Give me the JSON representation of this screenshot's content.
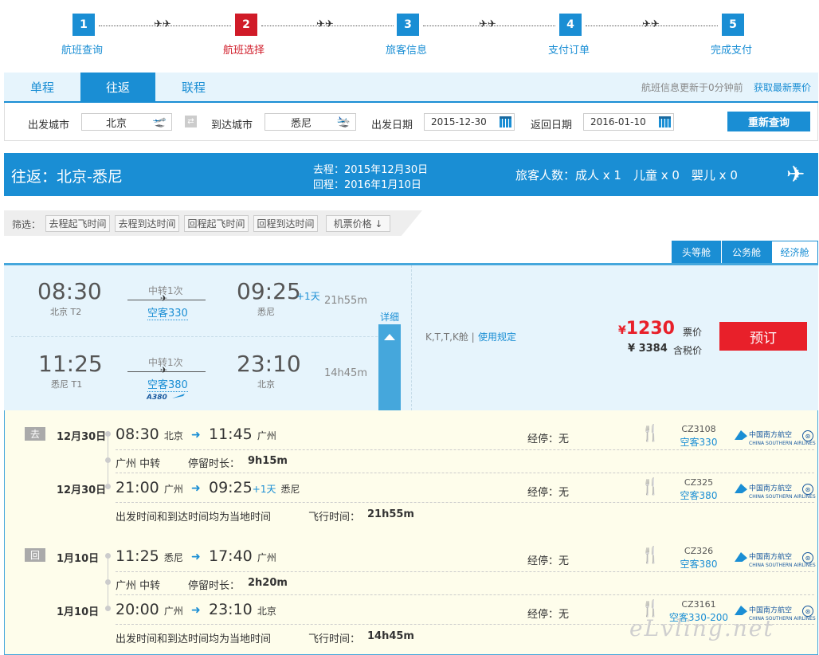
{
  "steps": [
    {
      "num": "1",
      "label": "航班查询"
    },
    {
      "num": "2",
      "label": "航班选择"
    },
    {
      "num": "3",
      "label": "旅客信息"
    },
    {
      "num": "4",
      "label": "支付订单"
    },
    {
      "num": "5",
      "label": "完成支付"
    }
  ],
  "trip_tabs": [
    "单程",
    "往返",
    "联程"
  ],
  "update_text": "航班信息更新于0分钟前",
  "refresh_link": "获取最新票价",
  "search": {
    "from_label": "出发城市",
    "from_value": "北京",
    "to_label": "到达城市",
    "to_value": "悉尼",
    "depart_label": "出发日期",
    "depart_value": "2015-12-30",
    "return_label": "返回日期",
    "return_value": "2016-01-10",
    "button": "重新查询"
  },
  "banner": {
    "route": "往返：北京-悉尼",
    "out_label": "去程：2015年12月30日",
    "ret_label": "回程：2016年1月10日",
    "pax": "旅客人数：成人 x 1　儿童 x 0　婴儿 x 0"
  },
  "filters": {
    "label": "筛选：",
    "items": [
      "去程起飞时间",
      "去程到达时间",
      "回程起飞时间",
      "回程到达时间",
      "机票价格 ↓"
    ]
  },
  "cabins": [
    "头等舱",
    "公务舱",
    "经济舱"
  ],
  "card": {
    "out": {
      "dep": "08:30",
      "dep_ap": "北京 T2",
      "transfer": "中转1次",
      "aircraft": "空客330",
      "arr": "09:25",
      "plus": "+1天",
      "arr_ap": "悉尼",
      "dur": "21h55m"
    },
    "ret": {
      "dep": "11:25",
      "dep_ap": "悉尼 T1",
      "transfer": "中转1次",
      "aircraft": "空客380",
      "arr": "23:10",
      "arr_ap": "北京",
      "dur": "14h45m"
    },
    "detail_label": "详细",
    "class_text": "K,T,T,K舱 |",
    "rules": "使用规定",
    "price": "1230",
    "price_unit": "票价",
    "tax_price": "¥ 3384",
    "tax_unit": "含税价",
    "book": "预订"
  },
  "details": {
    "out_tag": "去",
    "ret_tag": "回",
    "stop": "经停：无",
    "transfer_city": "广州 中转",
    "layover_label": "停留时长：",
    "local_note": "出发时间和到达时间均为当地时间",
    "flight_time_label": "飞行时间：",
    "airline": "中国南方航空",
    "airline_en": "CHINA SOUTHERN AIRLINES",
    "segments": [
      {
        "date": "12月30日",
        "dep": "08:30",
        "dep_city": "北京",
        "arr": "11:45",
        "arr_city": "广州",
        "plus": "",
        "fno": "CZ3108",
        "ac": "空客330"
      },
      {
        "date": "12月30日",
        "dep": "21:00",
        "dep_city": "广州",
        "arr": "09:25",
        "arr_city": "悉尼",
        "plus": "+1天",
        "fno": "CZ325",
        "ac": "空客380"
      },
      {
        "date": "1月10日",
        "dep": "11:25",
        "dep_city": "悉尼",
        "arr": "17:40",
        "arr_city": "广州",
        "plus": "",
        "fno": "CZ326",
        "ac": "空客380"
      },
      {
        "date": "1月10日",
        "dep": "20:00",
        "dep_city": "广州",
        "arr": "23:10",
        "arr_city": "北京",
        "plus": "",
        "fno": "CZ3161",
        "ac": "空客330-200"
      }
    ],
    "out_layover": "9h15m",
    "out_total": "21h55m",
    "ret_layover": "2h20m",
    "ret_total": "14h45m"
  },
  "watermark": "eLvling.net"
}
